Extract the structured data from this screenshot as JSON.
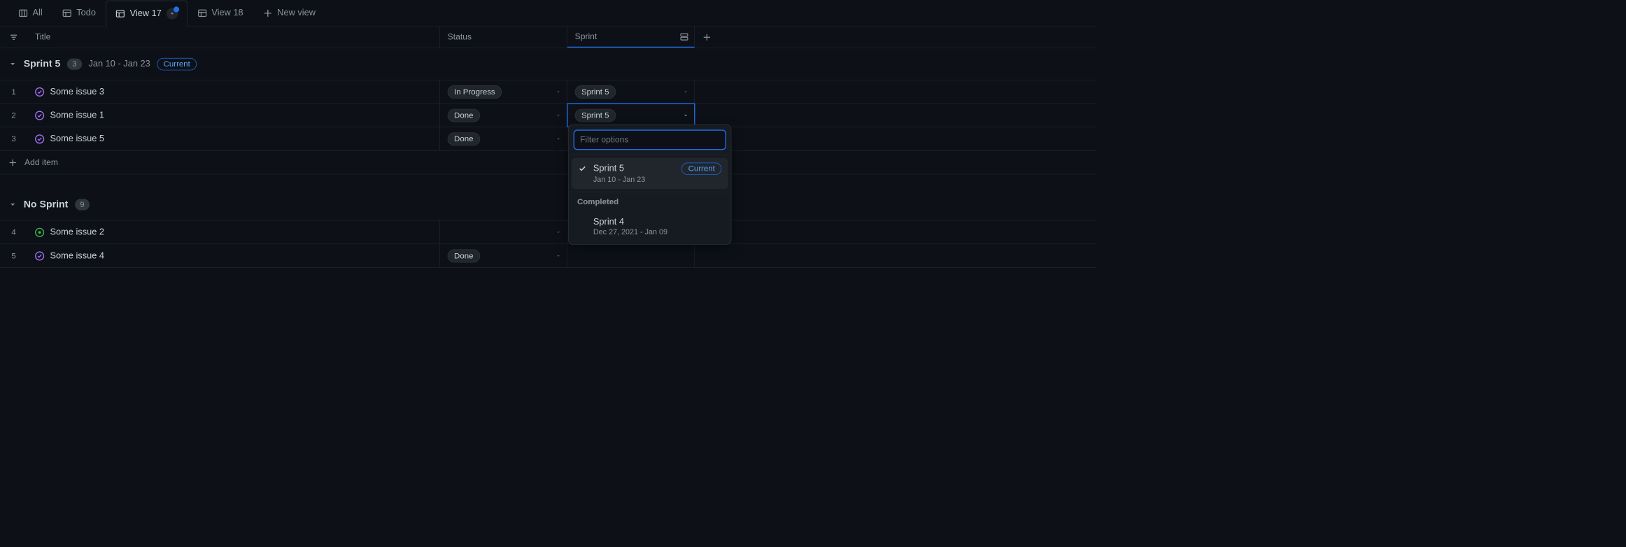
{
  "tabs": [
    {
      "label": "All",
      "icon": "board"
    },
    {
      "label": "Todo",
      "icon": "table"
    },
    {
      "label": "View 17",
      "icon": "table",
      "active": true,
      "has_indicator": true
    },
    {
      "label": "View 18",
      "icon": "table"
    }
  ],
  "new_view_label": "New view",
  "columns": {
    "title": "Title",
    "status": "Status",
    "sprint": "Sprint"
  },
  "groups": [
    {
      "title": "Sprint 5",
      "count": "3",
      "date_range": "Jan 10 - Jan 23",
      "badge": "Current",
      "rows": [
        {
          "n": "1",
          "title": "Some issue 3",
          "icon": "closed-purple",
          "status": "In Progress",
          "sprint": "Sprint 5"
        },
        {
          "n": "2",
          "title": "Some issue 1",
          "icon": "closed-purple",
          "status": "Done",
          "sprint": "Sprint 5",
          "sprint_active": true
        },
        {
          "n": "3",
          "title": "Some issue 5",
          "icon": "closed-purple",
          "status": "Done",
          "sprint": ""
        }
      ]
    },
    {
      "title": "No Sprint",
      "count": "9",
      "rows": [
        {
          "n": "4",
          "title": "Some issue 2",
          "icon": "open-green",
          "status": "",
          "sprint": ""
        },
        {
          "n": "5",
          "title": "Some issue 4",
          "icon": "closed-purple",
          "status": "Done",
          "sprint": ""
        }
      ]
    }
  ],
  "add_item_label": "Add item",
  "dropdown": {
    "filter_placeholder": "Filter options",
    "options": [
      {
        "title": "Sprint 5",
        "sub": "Jan 10 - Jan 23",
        "badge": "Current",
        "selected": true
      }
    ],
    "completed_label": "Completed",
    "completed_options": [
      {
        "title": "Sprint 4",
        "sub": "Dec 27, 2021 - Jan 09"
      }
    ]
  }
}
